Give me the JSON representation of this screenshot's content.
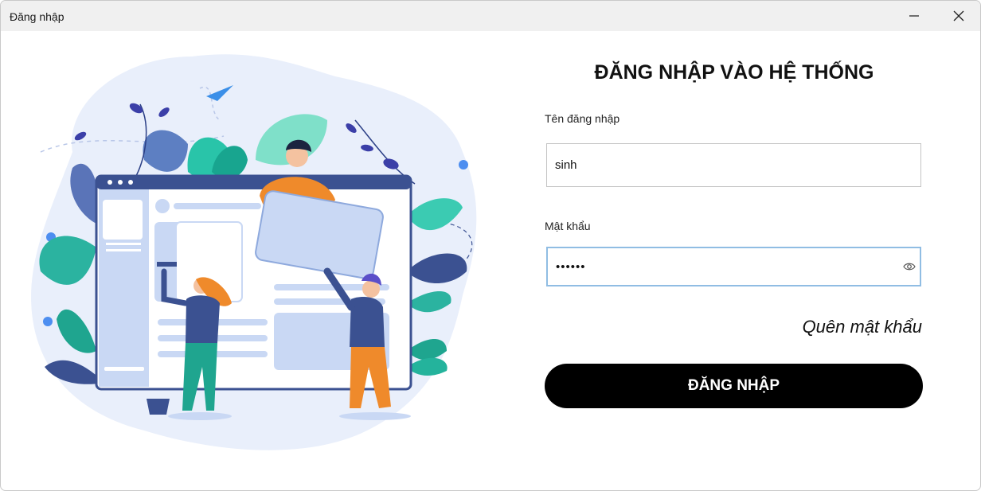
{
  "window": {
    "title": "Đăng nhập"
  },
  "form": {
    "heading": "ĐĂNG NHẬP VÀO HỆ THỐNG",
    "username_label": "Tên đăng nhập",
    "username_value": "sinh",
    "password_label": "Mật khẩu",
    "password_value": "123456",
    "forgot_link": "Quên mật khẩu",
    "submit_label": "ĐĂNG NHẬP"
  },
  "icons": {
    "minimize": "minimize-icon",
    "close": "close-icon",
    "show_password": "eye-icon"
  },
  "colors": {
    "button_bg": "#000000",
    "focus_border": "#90bde3",
    "illustration_blue": "#3b5191",
    "illustration_teal": "#1fa58f",
    "illustration_orange": "#ef8a2b"
  }
}
